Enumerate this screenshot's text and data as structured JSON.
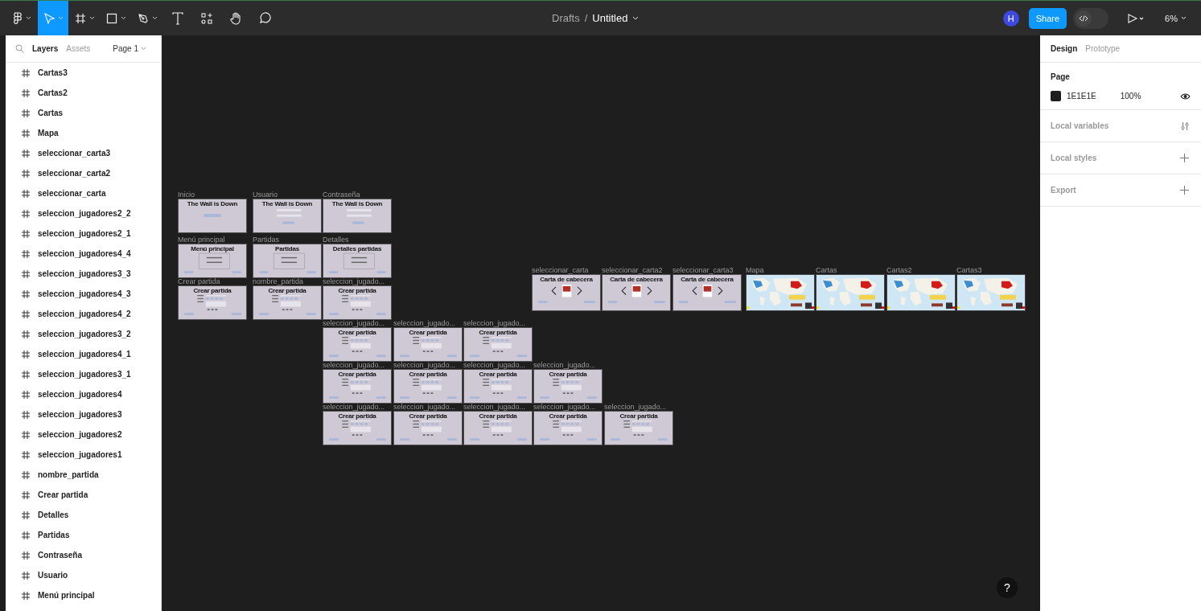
{
  "toolbar": {
    "tools": [
      {
        "kind": "menu",
        "selected": false
      },
      {
        "kind": "move",
        "selected": true
      },
      {
        "kind": "frame",
        "selected": false
      },
      {
        "kind": "rectangle",
        "selected": false
      },
      {
        "kind": "pen",
        "selected": false
      },
      {
        "kind": "text",
        "selected": false
      },
      {
        "kind": "resources",
        "selected": false
      },
      {
        "kind": "hand",
        "selected": false
      },
      {
        "kind": "comment",
        "selected": false
      }
    ],
    "breadcrumb": {
      "folder": "Drafts",
      "separator": "/",
      "file": "Untitled"
    },
    "avatar": "H",
    "share": "Share",
    "dev_mode": false,
    "zoom": "6%"
  },
  "left_panel": {
    "tabs": [
      {
        "label": "Layers",
        "selected": true
      },
      {
        "label": "Assets",
        "selected": false
      }
    ],
    "page": "Page 1",
    "layers": [
      "Cartas3",
      "Cartas2",
      "Cartas",
      "Mapa",
      "seleccionar_carta3",
      "seleccionar_carta2",
      "seleccionar_carta",
      "seleccion_jugadores2_2",
      "seleccion_jugadores2_1",
      "seleccion_jugadores4_4",
      "seleccion_jugadores3_3",
      "seleccion_jugadores4_3",
      "seleccion_jugadores4_2",
      "seleccion_jugadores3_2",
      "seleccion_jugadores4_1",
      "seleccion_jugadores3_1",
      "seleccion_jugadores4",
      "seleccion_jugadores3",
      "seleccion_jugadores2",
      "seleccion_jugadores1",
      "nombre_partida",
      "Crear partida",
      "Detalles",
      "Partidas",
      "Contraseña",
      "Usuario",
      "Menú principal"
    ]
  },
  "canvas": {
    "frames": [
      {
        "label": "Inicio",
        "title": "The Wall is Down",
        "kind": "start"
      },
      {
        "label": "Usuario",
        "title": "The Wall is Down",
        "kind": "login"
      },
      {
        "label": "Contraseña",
        "title": "The Wall is Down",
        "kind": "login"
      },
      {
        "label": "Menú principal",
        "title": "Menú principal",
        "kind": "menu"
      },
      {
        "label": "Partidas",
        "title": "Partidas",
        "kind": "menu"
      },
      {
        "label": "Detalles",
        "title": "Detalles partidas",
        "kind": "menu"
      },
      {
        "label": "Crear partida",
        "title": "Crear partida",
        "kind": "form"
      },
      {
        "label": "nombre_partida",
        "title": "Crear partida",
        "kind": "form"
      },
      {
        "label": "seleccion_jugado...",
        "title": "Crear partida",
        "kind": "form"
      },
      {
        "label": "seleccion_jugado...",
        "title": "Crear partida",
        "kind": "form"
      },
      {
        "label": "seleccion_jugado...",
        "title": "Crear partida",
        "kind": "form"
      },
      {
        "label": "seleccion_jugado...",
        "title": "Crear partida",
        "kind": "form"
      },
      {
        "label": "seleccion_jugado...",
        "title": "Crear partida",
        "kind": "form"
      },
      {
        "label": "seleccion_jugado...",
        "title": "Crear partida",
        "kind": "form"
      },
      {
        "label": "seleccion_jugado...",
        "title": "Crear partida",
        "kind": "form"
      },
      {
        "label": "seleccion_jugado...",
        "title": "Crear partida",
        "kind": "form"
      },
      {
        "label": "seleccion_jugado...",
        "title": "Crear partida",
        "kind": "form"
      },
      {
        "label": "seleccion_jugado...",
        "title": "Crear partida",
        "kind": "form"
      },
      {
        "label": "seleccion_jugado...",
        "title": "Crear partida",
        "kind": "form"
      },
      {
        "label": "seleccion_jugado...",
        "title": "Crear partida",
        "kind": "form"
      },
      {
        "label": "seleccion_jugado...",
        "title": "Crear partida",
        "kind": "form"
      },
      {
        "label": "seleccionar_carta",
        "title": "Carta de cabecera",
        "kind": "cards"
      },
      {
        "label": "seleccionar_carta2",
        "title": "Carta de cabecera",
        "kind": "cards"
      },
      {
        "label": "seleccionar_carta3",
        "title": "Carta de cabecera",
        "kind": "cards"
      },
      {
        "label": "Mapa"
      },
      {
        "label": "Cartas"
      },
      {
        "label": "Cartas2"
      },
      {
        "label": "Cartas3"
      }
    ],
    "help": "?"
  },
  "right_panel": {
    "tabs": [
      {
        "label": "Design",
        "selected": true
      },
      {
        "label": "Prototype",
        "selected": false
      }
    ],
    "page": {
      "heading": "Page",
      "color": "#1e1e1e",
      "hex": "1E1E1E",
      "opacity": "100%"
    },
    "sections": [
      {
        "label": "Local variables",
        "kind": "variables"
      },
      {
        "label": "Local styles",
        "kind": "add"
      },
      {
        "label": "Export",
        "kind": "add"
      }
    ]
  }
}
